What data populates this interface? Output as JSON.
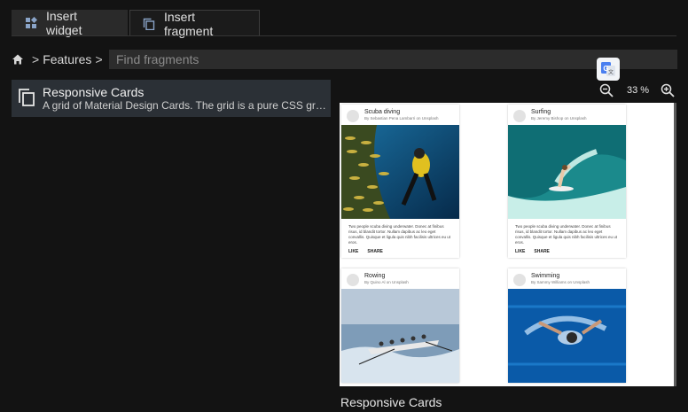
{
  "tabs": [
    {
      "label": "Insert widget",
      "icon": "widgets-icon"
    },
    {
      "label": "Insert fragment",
      "icon": "copy-icon"
    }
  ],
  "breadcrumb": {
    "home_icon": "home-icon",
    "section": "Features",
    "sep": ">"
  },
  "search": {
    "placeholder": "Find fragments",
    "value": ""
  },
  "fragments": [
    {
      "title": "Responsive Cards",
      "desc": "A grid of Material Design Cards. The grid is a pure CSS grid layout.",
      "icon": "copy-icon"
    }
  ],
  "toolbar": {
    "translate_icon": "google-translate-icon",
    "zoom_out_icon": "zoom-out-icon",
    "zoom_in_icon": "zoom-in-icon",
    "zoom": "33 %"
  },
  "preview": {
    "label": "Responsive Cards",
    "cards": [
      {
        "title": "Scuba diving",
        "byline": "By Sebastian Pena Lambarri on Unsplash",
        "text": "Two people scuba diving underwater. Donec at finibus risus, id blandit tortor. Nullam dapibus ac leo eget convallis. Quisque et ligula quis nibh facilisis ultrices eu ut eros.",
        "actions": [
          "LIKE",
          "SHARE"
        ]
      },
      {
        "title": "Surfing",
        "byline": "By Jeremy Bishop on Unsplash",
        "text": "Two people scuba diving underwater. Donec at finibus risus, id blandit tortor. Nullam dapibus ac leo eget convallis. Quisque et ligula quis nibh facilisis ultrices eu ut eros.",
        "actions": [
          "LIKE",
          "SHARE"
        ]
      },
      {
        "title": "Rowing",
        "byline": "By Quino Al on Unsplash",
        "text": "",
        "actions": []
      },
      {
        "title": "Swimming",
        "byline": "By Sammy Williams on Unsplash",
        "text": "",
        "actions": []
      }
    ]
  },
  "colors": {
    "bg": "#131313",
    "selected": "#2b3036",
    "search_bg": "#2c2c2c",
    "tab_inactive": "#2a2a2a"
  }
}
